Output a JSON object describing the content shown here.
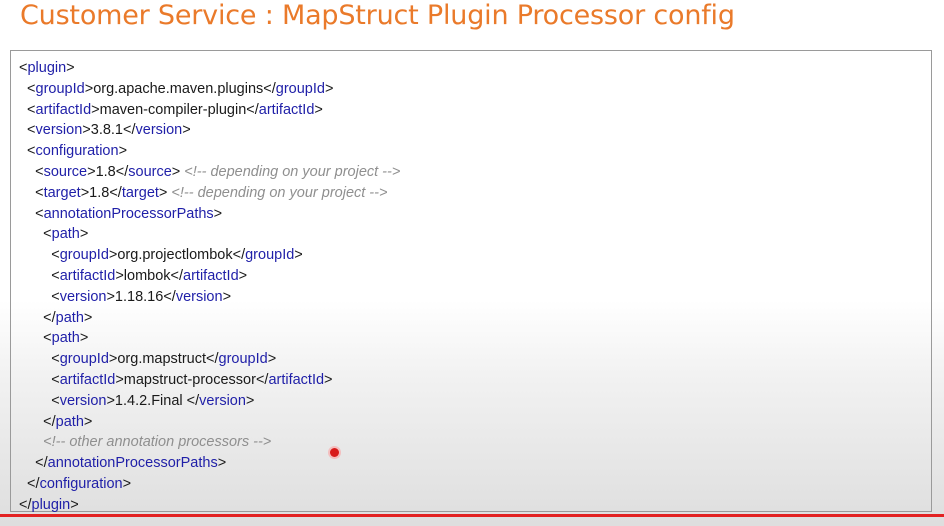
{
  "title": "Customer Service : MapStruct Plugin Processor config",
  "code": {
    "plugin_open": "plugin",
    "plugin_close": "plugin",
    "groupId_tag": "groupId",
    "groupId_value": "org.apache.maven.plugins",
    "artifactId_tag": "artifactId",
    "artifactId_value": "maven-compiler-plugin",
    "version_tag": "version",
    "version_value": "3.8.1",
    "configuration_tag": "configuration",
    "source_tag": "source",
    "source_value": "1.8",
    "source_comment": "<!-- depending on your project -->",
    "target_tag": "target",
    "target_value": "1.8",
    "target_comment": "<!-- depending on your project -->",
    "app_tag": "annotationProcessorPaths",
    "path_tag": "path",
    "lombok_groupId": "org.projectlombok",
    "lombok_artifactId": "lombok",
    "lombok_version": "1.18.16",
    "mapstruct_groupId": "org.mapstruct",
    "mapstruct_artifactId": "mapstruct-processor",
    "mapstruct_version": "1.4.2.Final ",
    "other_comment": "<!-- other annotation processors -->"
  },
  "colors": {
    "title": "#ea7a2a",
    "tag": "#1f1fa8",
    "comment": "#8f8f8f",
    "progress": "#e32222",
    "cursor": "#d81b1b"
  }
}
